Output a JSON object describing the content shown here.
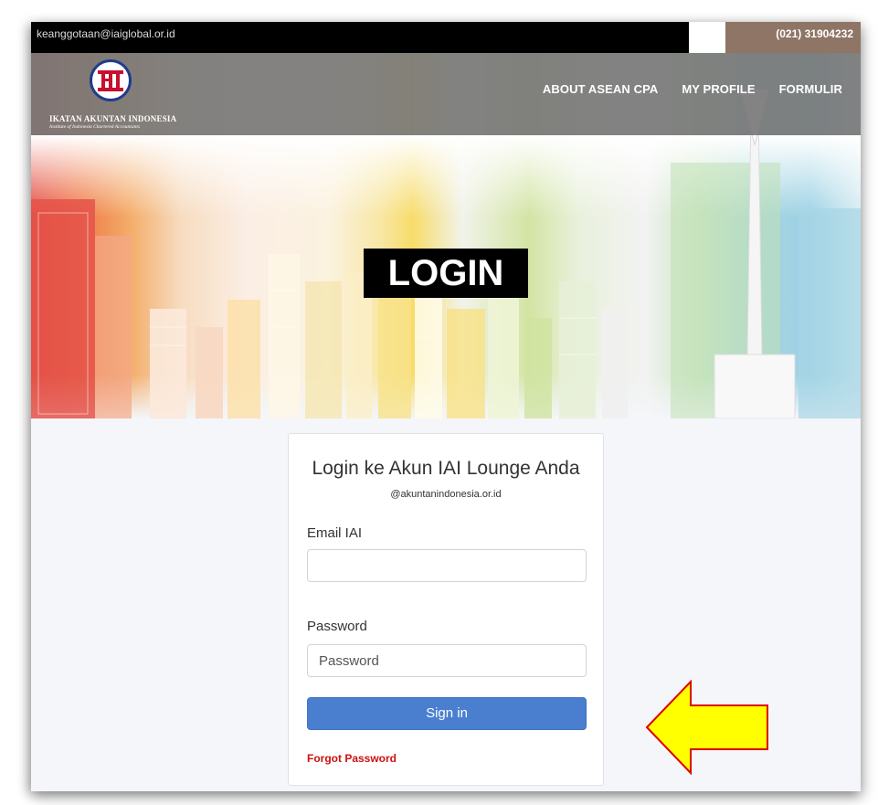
{
  "topbar": {
    "email": "keanggotaan@iaiglobal.or.id",
    "phone": "(021) 31904232",
    "email_bg": "#000000",
    "phone_bg": "#8f7565"
  },
  "logo": {
    "monogram": "IAI",
    "org_name": "IKATAN AKUNTAN INDONESIA",
    "org_tagline": "Institute of Indonesia Chartered Accountants"
  },
  "nav": {
    "items": [
      {
        "label": "ABOUT ASEAN CPA"
      },
      {
        "label": "MY PROFILE"
      },
      {
        "label": "FORMULIR"
      }
    ]
  },
  "hero": {
    "title": "LOGIN"
  },
  "login_card": {
    "title": "Login ke Akun IAI Lounge Anda",
    "subtitle": "@akuntanindonesia.or.id",
    "email_label": "Email IAI",
    "email_value": "",
    "email_placeholder": "",
    "password_label": "Password",
    "password_value": "",
    "password_placeholder": "Password",
    "signin_label": "Sign in",
    "forgot_label": "Forgot Password"
  },
  "colors": {
    "primary_button": "#4a7fd0",
    "forgot_link": "#cc1111",
    "annotation_arrow_fill": "#ffff00",
    "annotation_arrow_stroke": "#e00000"
  },
  "annotation": {
    "icon": "arrow-left-icon"
  }
}
